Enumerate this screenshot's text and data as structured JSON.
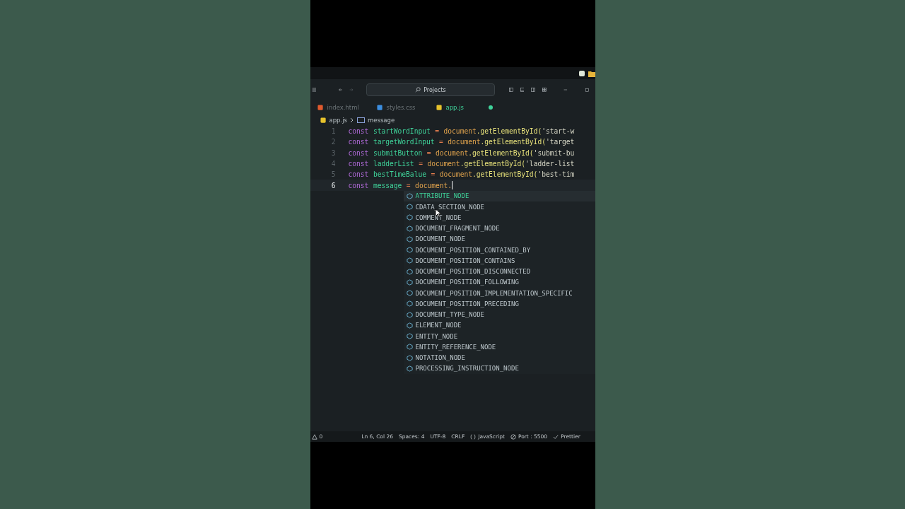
{
  "title_bar": {
    "search": "Projects"
  },
  "tabs": [
    {
      "label": "index.html",
      "kind": "html",
      "selected": false,
      "modified": false
    },
    {
      "label": "styles.css",
      "kind": "css",
      "selected": false,
      "modified": false
    },
    {
      "label": "app.js",
      "kind": "js",
      "selected": true,
      "modified": true
    }
  ],
  "breadcrumb": [
    {
      "label": "app.js",
      "kind": "file"
    },
    {
      "label": "message",
      "kind": "variable"
    }
  ],
  "code_lines": [
    {
      "number": "1",
      "current": false,
      "tokens": [
        {
          "kind": "keyword",
          "text": "const"
        },
        {
          "kind": "variable",
          "text": "startWordInput"
        },
        {
          "kind": "operator",
          "text": "="
        },
        {
          "kind": "object",
          "text": "document"
        },
        {
          "kind": "method",
          "text": ".getElementById("
        },
        {
          "kind": "string",
          "text": "'start-w"
        }
      ]
    },
    {
      "number": "2",
      "current": false,
      "tokens": [
        {
          "kind": "keyword",
          "text": "const"
        },
        {
          "kind": "variable",
          "text": "targetWordInput"
        },
        {
          "kind": "operator",
          "text": "="
        },
        {
          "kind": "object",
          "text": "document"
        },
        {
          "kind": "method",
          "text": ".getElementById("
        },
        {
          "kind": "string",
          "text": "'target"
        }
      ]
    },
    {
      "number": "3",
      "current": false,
      "tokens": [
        {
          "kind": "keyword",
          "text": "const"
        },
        {
          "kind": "variable",
          "text": "submitButton"
        },
        {
          "kind": "operator",
          "text": "="
        },
        {
          "kind": "object",
          "text": "document"
        },
        {
          "kind": "method",
          "text": ".getElementById("
        },
        {
          "kind": "string",
          "text": "'submit-bu"
        }
      ]
    },
    {
      "number": "4",
      "current": false,
      "tokens": [
        {
          "kind": "keyword",
          "text": "const"
        },
        {
          "kind": "variable",
          "text": "ladderList"
        },
        {
          "kind": "operator",
          "text": "="
        },
        {
          "kind": "object",
          "text": "document"
        },
        {
          "kind": "method",
          "text": ".getElementById("
        },
        {
          "kind": "string",
          "text": "'ladder-list"
        }
      ]
    },
    {
      "number": "5",
      "current": false,
      "tokens": [
        {
          "kind": "keyword",
          "text": "const"
        },
        {
          "kind": "variable",
          "text": "bestTimeBalue"
        },
        {
          "kind": "operator",
          "text": "="
        },
        {
          "kind": "object",
          "text": "document"
        },
        {
          "kind": "method",
          "text": ".getElementById("
        },
        {
          "kind": "string",
          "text": "'best-tim"
        }
      ]
    },
    {
      "number": "6",
      "current": true,
      "tokens": [
        {
          "kind": "keyword",
          "text": "const"
        },
        {
          "kind": "variable",
          "text": "message"
        },
        {
          "kind": "operator",
          "text": "="
        },
        {
          "kind": "object",
          "text": "document."
        }
      ]
    }
  ],
  "suggestions": [
    {
      "label": "ATTRIBUTE_NODE",
      "selected": true
    },
    {
      "label": "CDATA_SECTION_NODE",
      "selected": false
    },
    {
      "label": "COMMENT_NODE",
      "selected": false
    },
    {
      "label": "DOCUMENT_FRAGMENT_NODE",
      "selected": false
    },
    {
      "label": "DOCUMENT_NODE",
      "selected": false
    },
    {
      "label": "DOCUMENT_POSITION_CONTAINED_BY",
      "selected": false
    },
    {
      "label": "DOCUMENT_POSITION_CONTAINS",
      "selected": false
    },
    {
      "label": "DOCUMENT_POSITION_DISCONNECTED",
      "selected": false
    },
    {
      "label": "DOCUMENT_POSITION_FOLLOWING",
      "selected": false
    },
    {
      "label": "DOCUMENT_POSITION_IMPLEMENTATION_SPECIFIC",
      "selected": false
    },
    {
      "label": "DOCUMENT_POSITION_PRECEDING",
      "selected": false
    },
    {
      "label": "DOCUMENT_TYPE_NODE",
      "selected": false
    },
    {
      "label": "ELEMENT_NODE",
      "selected": false
    },
    {
      "label": "ENTITY_NODE",
      "selected": false
    },
    {
      "label": "ENTITY_REFERENCE_NODE",
      "selected": false
    },
    {
      "label": "NOTATION_NODE",
      "selected": false
    },
    {
      "label": "PROCESSING_INSTRUCTION_NODE",
      "selected": false
    }
  ],
  "status_bar": {
    "problems": "0",
    "items": [
      {
        "kind": "text",
        "label": "Ln 6, Col 26"
      },
      {
        "kind": "text",
        "label": "Spaces: 4"
      },
      {
        "kind": "text",
        "label": "UTF-8"
      },
      {
        "kind": "text",
        "label": "CRLF"
      },
      {
        "kind": "language",
        "label": "JavaScript"
      },
      {
        "kind": "port",
        "label": "Port : 5500"
      },
      {
        "kind": "check",
        "label": "Prettier"
      }
    ]
  }
}
